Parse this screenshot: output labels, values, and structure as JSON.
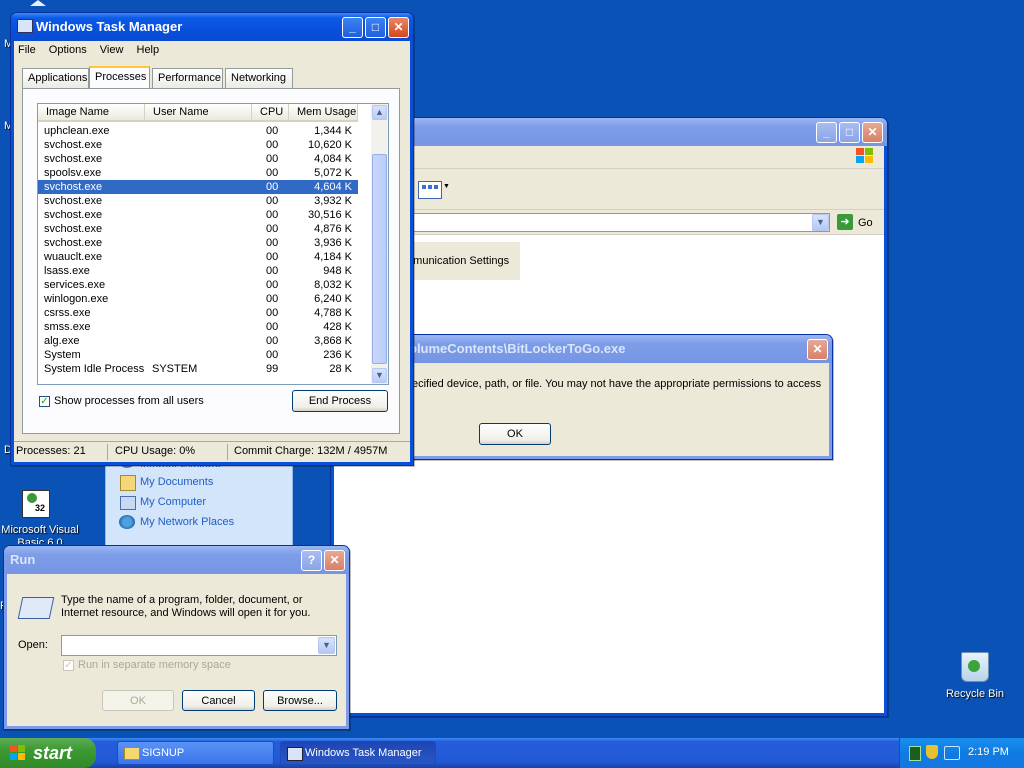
{
  "desktop": {
    "icons": [
      {
        "label": "Microsoft Visual Basic 6.0"
      },
      {
        "label": "Recycle Bin"
      }
    ]
  },
  "task_manager": {
    "title": "Windows Task Manager",
    "menu": [
      "File",
      "Options",
      "View",
      "Help"
    ],
    "tabs": [
      "Applications",
      "Processes",
      "Performance",
      "Networking"
    ],
    "active_tab": "Processes",
    "columns": [
      "Image Name",
      "User Name",
      "CPU",
      "Mem Usage"
    ],
    "processes": [
      {
        "name": "uphclean.exe",
        "user": "",
        "cpu": "00",
        "mem": "1,344 K"
      },
      {
        "name": "svchost.exe",
        "user": "",
        "cpu": "00",
        "mem": "10,620 K"
      },
      {
        "name": "svchost.exe",
        "user": "",
        "cpu": "00",
        "mem": "4,084 K"
      },
      {
        "name": "spoolsv.exe",
        "user": "",
        "cpu": "00",
        "mem": "5,072 K"
      },
      {
        "name": "svchost.exe",
        "user": "",
        "cpu": "00",
        "mem": "4,604 K"
      },
      {
        "name": "svchost.exe",
        "user": "",
        "cpu": "00",
        "mem": "3,932 K"
      },
      {
        "name": "svchost.exe",
        "user": "",
        "cpu": "00",
        "mem": "30,516 K"
      },
      {
        "name": "svchost.exe",
        "user": "",
        "cpu": "00",
        "mem": "4,876 K"
      },
      {
        "name": "svchost.exe",
        "user": "",
        "cpu": "00",
        "mem": "3,936 K"
      },
      {
        "name": "wuauclt.exe",
        "user": "",
        "cpu": "00",
        "mem": "4,184 K"
      },
      {
        "name": "lsass.exe",
        "user": "",
        "cpu": "00",
        "mem": "948 K"
      },
      {
        "name": "services.exe",
        "user": "",
        "cpu": "00",
        "mem": "8,032 K"
      },
      {
        "name": "winlogon.exe",
        "user": "",
        "cpu": "00",
        "mem": "6,240 K"
      },
      {
        "name": "csrss.exe",
        "user": "",
        "cpu": "00",
        "mem": "4,788 K"
      },
      {
        "name": "smss.exe",
        "user": "",
        "cpu": "00",
        "mem": "428 K"
      },
      {
        "name": "alg.exe",
        "user": "",
        "cpu": "00",
        "mem": "3,868 K"
      },
      {
        "name": "System",
        "user": "",
        "cpu": "00",
        "mem": "236 K"
      },
      {
        "name": "System Idle Process",
        "user": "SYSTEM",
        "cpu": "99",
        "mem": "28 K"
      }
    ],
    "selected_row": 4,
    "show_all_label": "Show processes from all users",
    "show_all_checked": true,
    "end_process_label": "End Process",
    "status": {
      "processes": "Processes: 21",
      "cpu": "CPU Usage: 0%",
      "commit": "Commit Charge: 132M / 4957M"
    }
  },
  "explorer": {
    "go_label": "Go",
    "comm_settings_text": "mmunication Settings",
    "links": [
      "Internet Explorer",
      "My Documents",
      "My Computer",
      "My Network Places"
    ]
  },
  "error_dialog": {
    "title": "olumeContents\\BitLockerToGo.exe",
    "message": "ecified device, path, or file.  You may not have the appropriate permissions to access",
    "ok_label": "OK"
  },
  "run_dialog": {
    "title": "Run",
    "description_line1": "Type the name of a program, folder, document, or",
    "description_line2": "Internet resource, and Windows will open it for you.",
    "open_label": "Open:",
    "open_value": "",
    "separate_memory_label": "Run in separate memory space",
    "ok_label": "OK",
    "cancel_label": "Cancel",
    "browse_label": "Browse..."
  },
  "taskbar": {
    "start_label": "start",
    "items": [
      {
        "label": "SIGNUP"
      },
      {
        "label": "Windows Task Manager"
      }
    ],
    "clock": "2:19 PM"
  },
  "colors": {
    "desktop": "#0b52b6",
    "title_active": "#0a4bd0",
    "selection": "#316ac5",
    "taskbar": "#245edb"
  }
}
